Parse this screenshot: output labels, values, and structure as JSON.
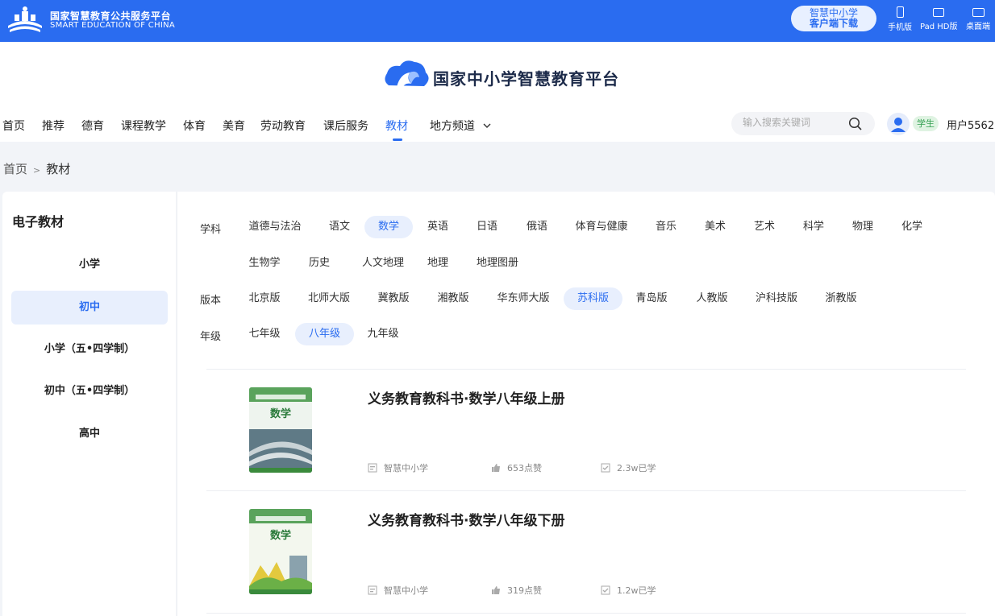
{
  "topbar": {
    "title": "国家智慧教育公共服务平台",
    "subtitle": "SMART EDUCATION OF CHINA",
    "download_line1": "智慧中小学",
    "download_line2": "客户端下载",
    "devices": [
      {
        "label": "手机版",
        "icon": "phone-icon"
      },
      {
        "label": "Pad HD版",
        "icon": "tablet-icon"
      },
      {
        "label": "桌面端",
        "icon": "desktop-icon"
      }
    ],
    "bg_color": "#2a6cf0"
  },
  "platform": {
    "name": "国家中小学智慧教育平台"
  },
  "nav": {
    "items": [
      "首页",
      "推荐",
      "德育",
      "课程教学",
      "体育",
      "美育",
      "劳动教育",
      "课后服务",
      "教材",
      "地方频道"
    ],
    "active": "教材",
    "search_placeholder": "输入搜索关键词",
    "role_badge": "学生",
    "username": "用户5562"
  },
  "breadcrumb": {
    "home": "首页",
    "sep": ">",
    "current": "教材"
  },
  "sidebar": {
    "title": "电子教材",
    "items": [
      "小学",
      "初中",
      "小学（五•四学制）",
      "初中（五•四学制）",
      "高中"
    ],
    "active": "初中"
  },
  "filters": {
    "subject_label": "学科",
    "subjects": [
      "道德与法治",
      "语文",
      "数学",
      "英语",
      "日语",
      "俄语",
      "体育与健康",
      "音乐",
      "美术",
      "艺术",
      "科学",
      "物理",
      "化学",
      "生物学",
      "历史",
      "人文地理",
      "地理",
      "地理图册"
    ],
    "subject_active": "数学",
    "edition_label": "版本",
    "editions": [
      "北京版",
      "北师大版",
      "冀教版",
      "湘教版",
      "华东师大版",
      "苏科版",
      "青岛版",
      "人教版",
      "沪科技版",
      "浙教版"
    ],
    "edition_active": "苏科版",
    "grade_label": "年级",
    "grades": [
      "七年级",
      "八年级",
      "九年级"
    ],
    "grade_active": "八年级"
  },
  "books": [
    {
      "title": "义务教育教科书·数学八年级上册",
      "publisher": "智慧中小学",
      "likes": "653点赞",
      "learners": "2.3w已学",
      "cover_subject": "数学"
    },
    {
      "title": "义务教育教科书·数学八年级下册",
      "publisher": "智慧中小学",
      "likes": "319点赞",
      "learners": "1.2w已学",
      "cover_subject": "数学"
    }
  ]
}
